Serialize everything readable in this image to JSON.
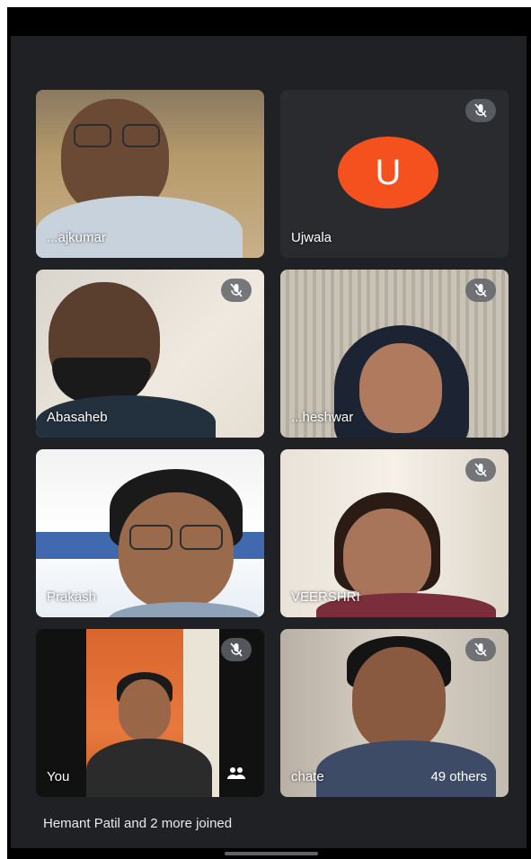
{
  "meeting": {
    "participants": [
      {
        "name": "...ajkumar",
        "muted": false,
        "has_video": true
      },
      {
        "name": "Ujwala",
        "muted": true,
        "has_video": false,
        "avatar_letter": "U",
        "avatar_color": "#f4511e"
      },
      {
        "name": "Abasaheb",
        "muted": true,
        "has_video": true
      },
      {
        "name": "...heshwar",
        "muted": true,
        "has_video": true
      },
      {
        "name": "Prakash",
        "muted": false,
        "has_video": true
      },
      {
        "name": "VEERSHRI",
        "muted": true,
        "has_video": true
      },
      {
        "name": "You",
        "muted": true,
        "has_video": true
      },
      {
        "name": "chate",
        "muted": true,
        "has_video": true
      }
    ],
    "others_count": "49 others",
    "notification": "Hemant Patil and 2 more joined"
  },
  "colors": {
    "background": "#202124",
    "tile": "#3c4043",
    "avatar": "#f4511e"
  },
  "icons": [
    "mic-off-icon",
    "people-icon"
  ]
}
